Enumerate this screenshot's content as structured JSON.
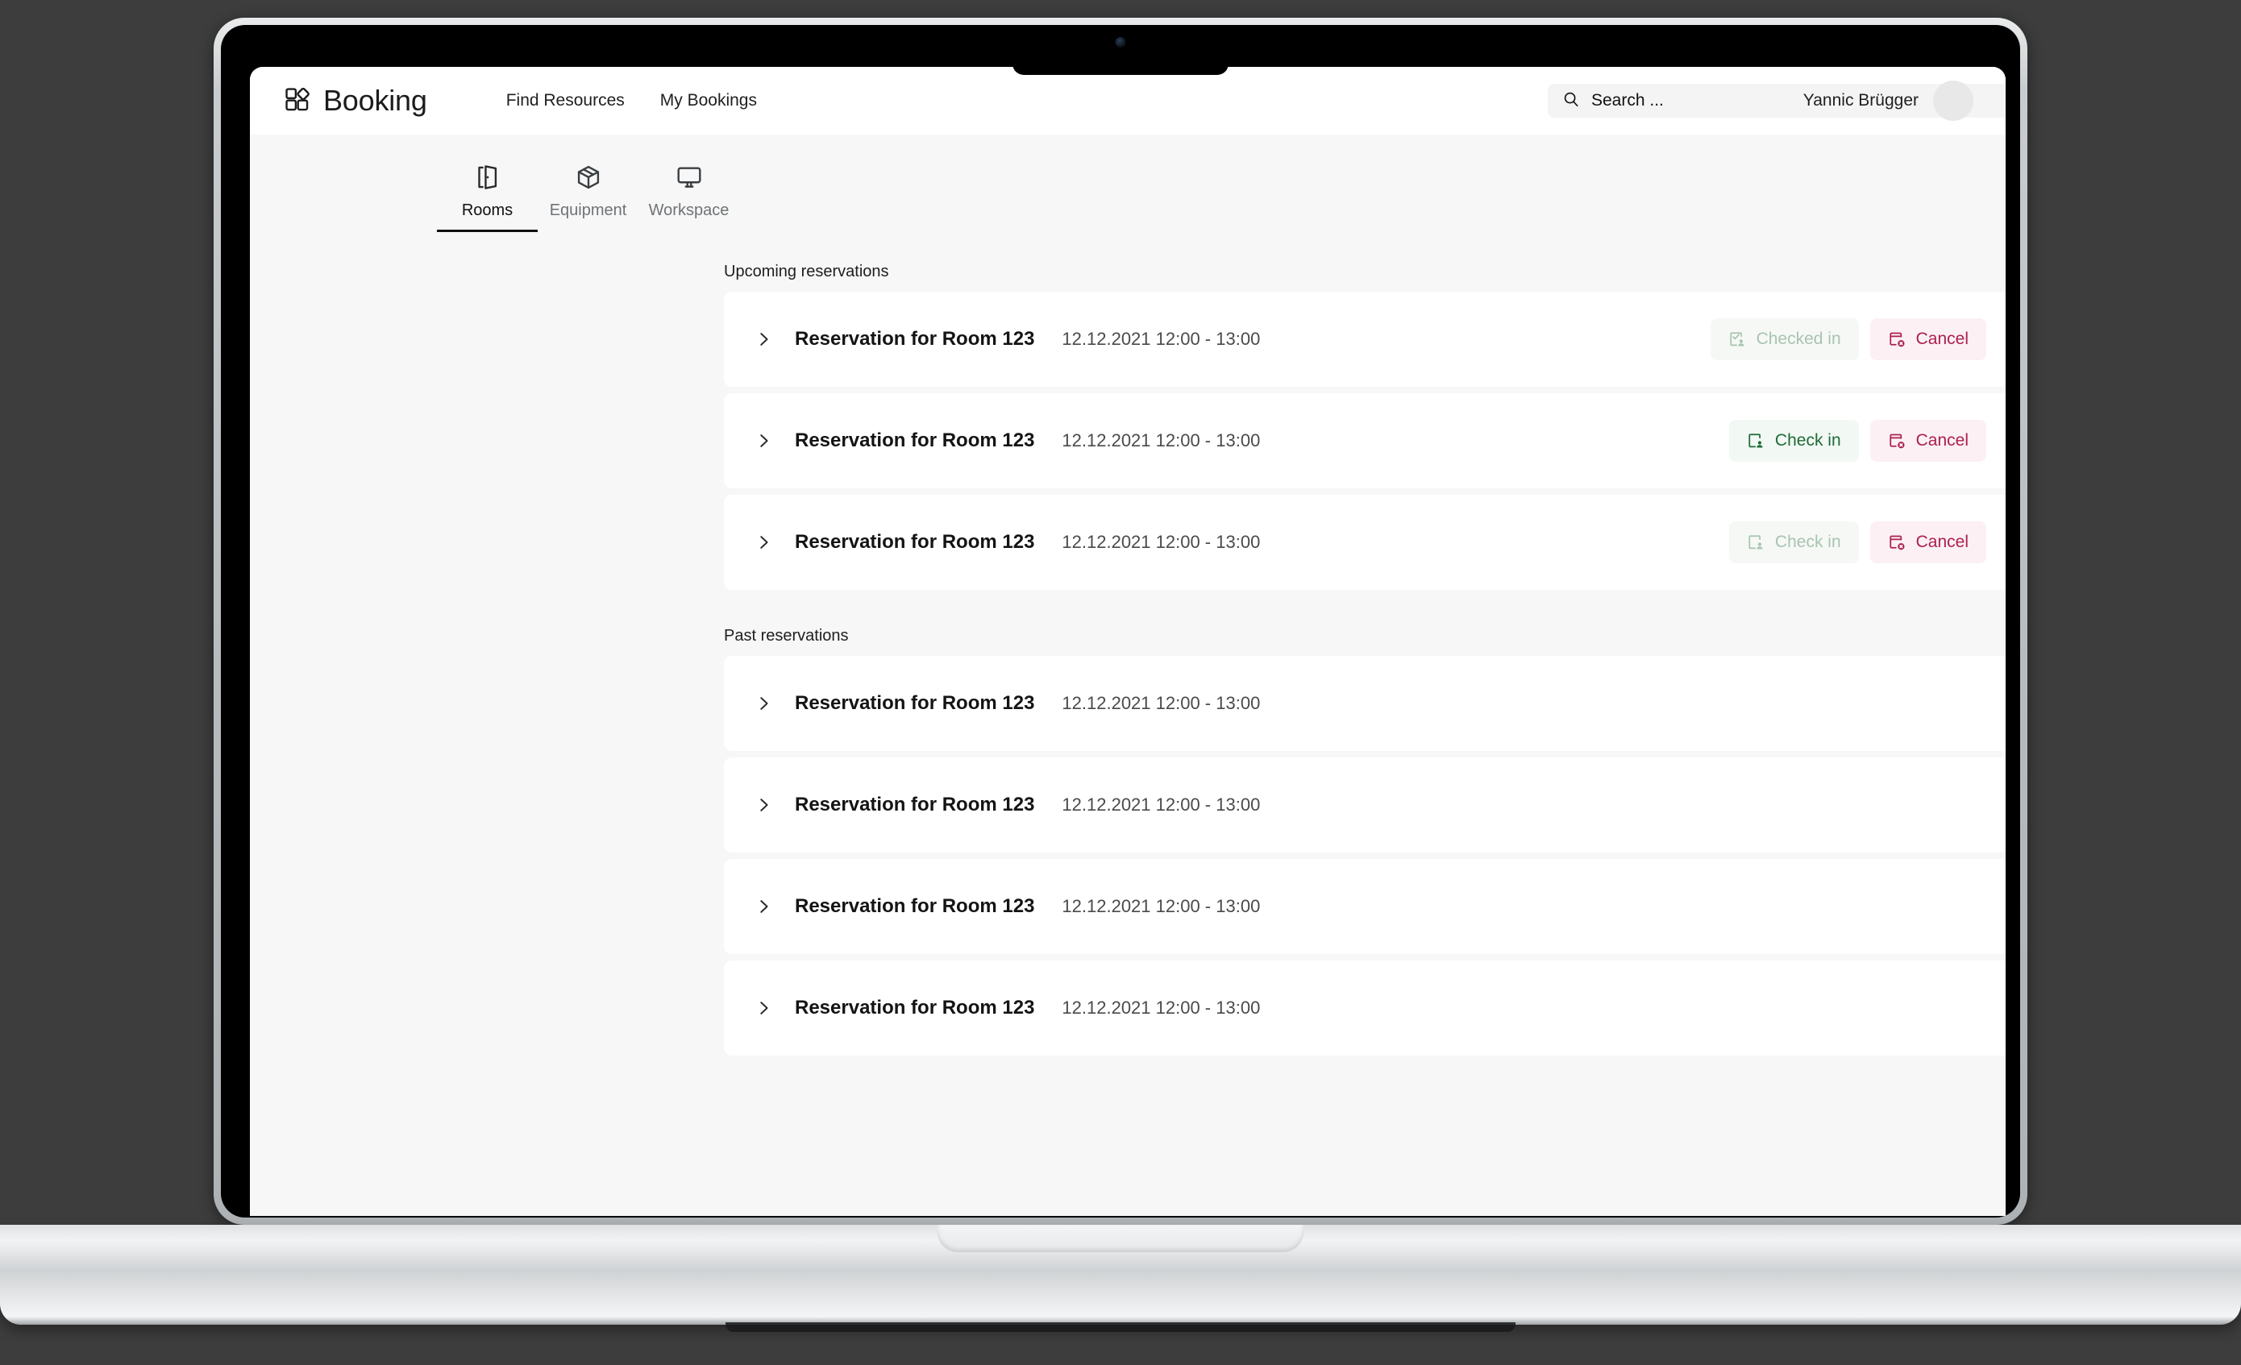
{
  "app": {
    "brand": "Booking",
    "logo_icon": "grid-blocks-logo-icon"
  },
  "nav": {
    "items": [
      {
        "label": "Find Resources",
        "name": "nav-find-resources"
      },
      {
        "label": "My Bookings",
        "name": "nav-my-bookings"
      }
    ]
  },
  "search": {
    "placeholder": "Search ...",
    "value": "Search ...",
    "icon": "search-icon"
  },
  "user": {
    "name": "Yannic Brügger",
    "avatar_icon": "avatar"
  },
  "tabs": [
    {
      "label": "Rooms",
      "icon": "door-open-icon",
      "active": true
    },
    {
      "label": "Equipment",
      "icon": "box-package-icon",
      "active": false
    },
    {
      "label": "Workspace",
      "icon": "monitor-icon",
      "active": false
    }
  ],
  "sections": [
    {
      "title": "Upcoming reservations",
      "rows": [
        {
          "title": "Reservation for Room 123",
          "date": "12.12.2021 12:00 - 13:00",
          "chevron_icon": "chevron-right-icon",
          "checkin": {
            "label": "Checked in",
            "state": "done",
            "icon": "checked-in-icon"
          },
          "cancel": {
            "label": "Cancel",
            "state": "enabled",
            "icon": "cancel-booking-icon"
          }
        },
        {
          "title": "Reservation for Room 123",
          "date": "12.12.2021 12:00 - 13:00",
          "chevron_icon": "chevron-right-icon",
          "checkin": {
            "label": "Check in",
            "state": "enabled",
            "icon": "check-in-icon"
          },
          "cancel": {
            "label": "Cancel",
            "state": "enabled",
            "icon": "cancel-booking-icon"
          }
        },
        {
          "title": "Reservation for Room 123",
          "date": "12.12.2021 12:00 - 13:00",
          "chevron_icon": "chevron-right-icon",
          "checkin": {
            "label": "Check in",
            "state": "disabled",
            "icon": "check-in-icon"
          },
          "cancel": {
            "label": "Cancel",
            "state": "enabled",
            "icon": "cancel-booking-icon"
          }
        }
      ]
    },
    {
      "title": "Past reservations",
      "rows": [
        {
          "title": "Reservation for Room 123",
          "date": "12.12.2021 12:00 - 13:00",
          "chevron_icon": "chevron-right-icon"
        },
        {
          "title": "Reservation for Room 123",
          "date": "12.12.2021 12:00 - 13:00",
          "chevron_icon": "chevron-right-icon"
        },
        {
          "title": "Reservation for Room 123",
          "date": "12.12.2021 12:00 - 13:00",
          "chevron_icon": "chevron-right-icon"
        },
        {
          "title": "Reservation for Room 123",
          "date": "12.12.2021 12:00 - 13:00",
          "chevron_icon": "chevron-right-icon"
        }
      ]
    }
  ],
  "colors": {
    "page_bg": "#f7f7f7",
    "card_bg": "#ffffff",
    "text": "#141414",
    "muted_text": "#4a4a4a",
    "green": "#1f6b38",
    "green_bg": "#f2f8f3",
    "green_muted": "#a8c4b0",
    "crimson": "#ab2050",
    "crimson_bg": "#fcf0f4"
  }
}
